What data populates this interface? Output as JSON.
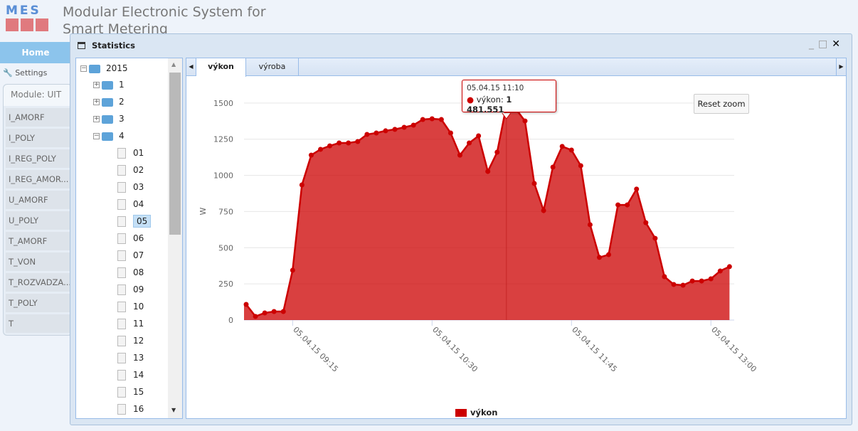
{
  "app": {
    "logo_text": "MES",
    "title": "Modular Electronic System for Smart Metering"
  },
  "nav": {
    "home": "Home",
    "settings": "Settings"
  },
  "module": {
    "title": "Module: UIT",
    "items": [
      "I_AMORF",
      "I_POLY",
      "I_REG_POLY",
      "I_REG_AMOR...",
      "U_AMORF",
      "U_POLY",
      "T_AMORF",
      "T_VON",
      "T_ROZVADZA...",
      "T_POLY",
      "T"
    ]
  },
  "window": {
    "title": "Statistics"
  },
  "tree": {
    "year": "2015",
    "months": [
      "1",
      "2",
      "3",
      "4"
    ],
    "days": [
      "01",
      "02",
      "03",
      "04",
      "05",
      "06",
      "07",
      "08",
      "09",
      "10",
      "11",
      "12",
      "13",
      "14",
      "15",
      "16"
    ],
    "selected_day": "05"
  },
  "tabs": [
    {
      "label": "výkon",
      "active": true
    },
    {
      "label": "výroba",
      "active": false
    }
  ],
  "chart": {
    "reset_zoom": "Reset zoom",
    "tooltip_time": "05.04.15 11:10",
    "tooltip_series": "výkon:",
    "tooltip_value": "1 481.551"
  },
  "chart_data": {
    "type": "area",
    "title": "",
    "ylabel": "W",
    "ylim": [
      0,
      1750
    ],
    "yticks": [
      "0",
      "250",
      "500",
      "750",
      "1000",
      "1250",
      "1500",
      "1750"
    ],
    "xticks": [
      "05.04.15 09:15",
      "05.04.15 10:30",
      "05.04.15 11:45",
      "05.04.15 13:00"
    ],
    "xtick_minutes": [
      25,
      100,
      175,
      250
    ],
    "x_start": "05.04.15 08:50",
    "x_step_minutes": 5,
    "legend": "výkon",
    "color": "#cc0000",
    "series": [
      {
        "name": "výkon",
        "values": [
          108,
          25,
          49,
          59,
          59,
          344,
          934,
          1140,
          1180,
          1204,
          1224,
          1224,
          1234,
          1283,
          1293,
          1308,
          1318,
          1332,
          1347,
          1386,
          1391,
          1386,
          1293,
          1140,
          1224,
          1273,
          1027,
          1160,
          1481.551,
          1460,
          1376,
          944,
          757,
          1057,
          1200,
          1175,
          1067,
          659,
          433,
          452,
          796,
          796,
          905,
          673,
          565,
          300,
          246,
          241,
          270,
          270,
          285,
          339,
          369
        ]
      }
    ]
  }
}
